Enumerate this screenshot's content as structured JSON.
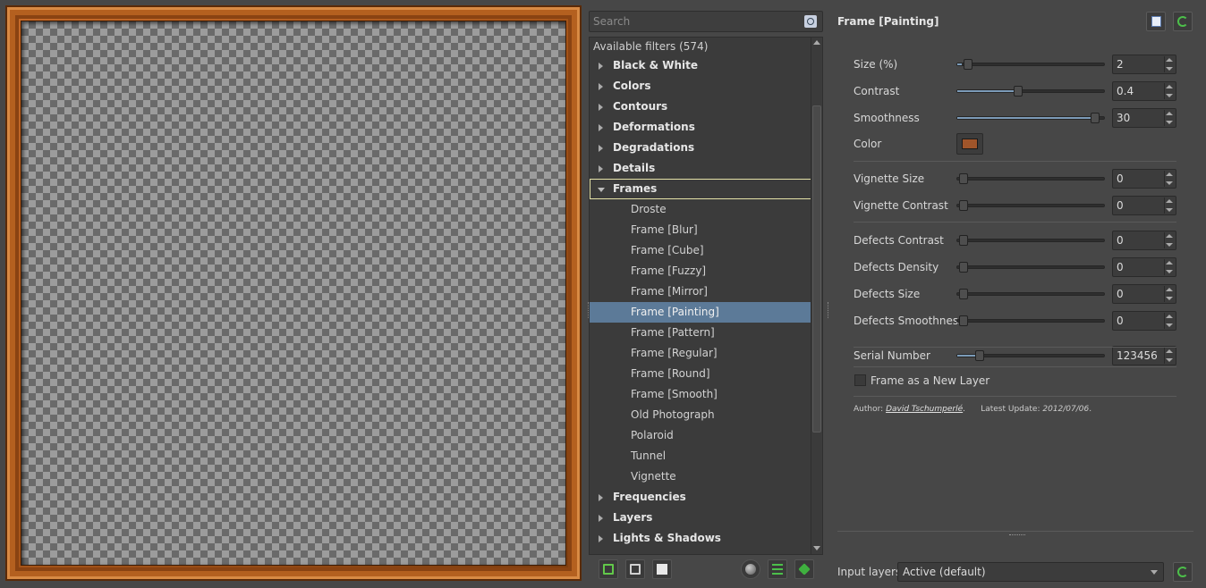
{
  "search": {
    "placeholder": "Search"
  },
  "tree": {
    "header": "Available filters (574)",
    "rows": [
      {
        "label": "Black & White",
        "type": "cat"
      },
      {
        "label": "Colors",
        "type": "cat"
      },
      {
        "label": "Contours",
        "type": "cat"
      },
      {
        "label": "Deformations",
        "type": "cat"
      },
      {
        "label": "Degradations",
        "type": "cat"
      },
      {
        "label": "Details",
        "type": "cat"
      },
      {
        "label": "Frames",
        "type": "cat-open"
      },
      {
        "label": "Droste",
        "type": "leaf"
      },
      {
        "label": "Frame [Blur]",
        "type": "leaf"
      },
      {
        "label": "Frame [Cube]",
        "type": "leaf"
      },
      {
        "label": "Frame [Fuzzy]",
        "type": "leaf"
      },
      {
        "label": "Frame [Mirror]",
        "type": "leaf"
      },
      {
        "label": "Frame [Painting]",
        "type": "leaf-selected"
      },
      {
        "label": "Frame [Pattern]",
        "type": "leaf"
      },
      {
        "label": "Frame [Regular]",
        "type": "leaf"
      },
      {
        "label": "Frame [Round]",
        "type": "leaf"
      },
      {
        "label": "Frame [Smooth]",
        "type": "leaf"
      },
      {
        "label": "Old Photograph",
        "type": "leaf"
      },
      {
        "label": "Polaroid",
        "type": "leaf"
      },
      {
        "label": "Tunnel",
        "type": "leaf"
      },
      {
        "label": "Vignette",
        "type": "leaf"
      },
      {
        "label": "Frequencies",
        "type": "cat"
      },
      {
        "label": "Layers",
        "type": "cat"
      },
      {
        "label": "Lights & Shadows",
        "type": "cat"
      }
    ]
  },
  "filter": {
    "title": "Frame [Painting]",
    "params": {
      "size": {
        "label": "Size (%)",
        "value": "2",
        "fraction": 0.03
      },
      "contrast": {
        "label": "Contrast",
        "value": "0.4",
        "fraction": 0.4
      },
      "smoothness": {
        "label": "Smoothness",
        "value": "30",
        "fraction": 0.97
      },
      "color": {
        "label": "Color",
        "hex": "#a0552a"
      },
      "vignette_size": {
        "label": "Vignette Size",
        "value": "0",
        "fraction": 0
      },
      "vignette_contrast": {
        "label": "Vignette Contrast",
        "value": "0",
        "fraction": 0
      },
      "defects_contrast": {
        "label": "Defects Contrast",
        "value": "0",
        "fraction": 0
      },
      "defects_density": {
        "label": "Defects Density",
        "value": "0",
        "fraction": 0
      },
      "defects_size": {
        "label": "Defects Size",
        "value": "0",
        "fraction": 0
      },
      "defects_smoothness": {
        "label": "Defects Smoothness",
        "value": "0",
        "fraction": 0
      },
      "serial_number": {
        "label": "Serial Number",
        "value": "123456",
        "fraction": 0.12
      }
    },
    "new_layer_label": "Frame as a New Layer",
    "author_prefix": "Author:",
    "author_name": "David Tschumperlé",
    "author_suffix": ".",
    "update_prefix": "Latest Update:",
    "update_date": "2012/07/06",
    "update_suffix": "."
  },
  "input_layers": {
    "label": "Input layers",
    "value": "Active (default)"
  },
  "colors": {
    "accent": "#5c7a98",
    "frame": "#b4601f"
  },
  "icons": {
    "filter_header": [
      "copy-icon",
      "refresh-icon"
    ],
    "bottom_tools": [
      "add-fave-icon",
      "remove-fave-icon",
      "rename-icon",
      "sphere-icon",
      "list-icon",
      "update-icon"
    ]
  }
}
